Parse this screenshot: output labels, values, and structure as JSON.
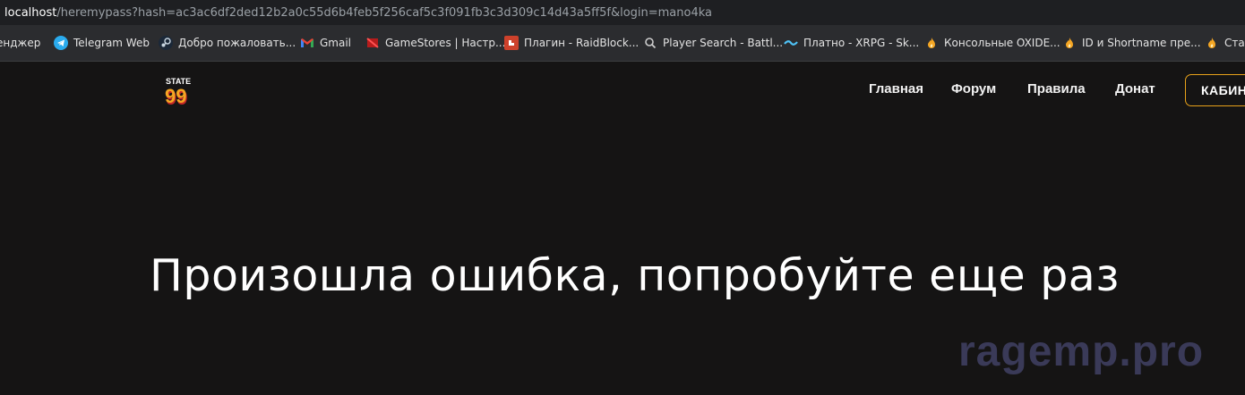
{
  "browser": {
    "address": {
      "host": "localhost",
      "path": "/heremypass?hash=ac3ac6df2ded12b2a0c55d6b4feb5f256caf5c3f091fb3c3d309c14d43a5ff5f&login=mano4ka"
    },
    "bookmarks": [
      {
        "label": "енджер",
        "icon": "none"
      },
      {
        "label": "Telegram Web",
        "icon": "telegram-icon",
        "color": "#2aabee"
      },
      {
        "label": "Добро пожаловать...",
        "icon": "steam-icon",
        "color": "#c7d5e0"
      },
      {
        "label": "Gmail",
        "icon": "gmail-icon",
        "color": "#ea4335"
      },
      {
        "label": "GameStores | Настр...",
        "icon": "gamestores-icon",
        "color": "#e53935"
      },
      {
        "label": "Плагин - RaidBlock...",
        "icon": "rust-icon",
        "color": "#cd412b"
      },
      {
        "label": "Player Search - Battl...",
        "icon": "search-icon",
        "color": "#cccccc"
      },
      {
        "label": "Платно - XRPG - Sk...",
        "icon": "xrpg-icon",
        "color": "#4fc3f7"
      },
      {
        "label": "Консольные OXIDE...",
        "icon": "flame-icon",
        "color": "#f5a623"
      },
      {
        "label": "ID и Shortname пре...",
        "icon": "flame-icon",
        "color": "#f5a623"
      },
      {
        "label": "Стан",
        "icon": "flame-icon",
        "color": "#f5a623"
      }
    ]
  },
  "site": {
    "logo": {
      "top": "STATE",
      "number": "99"
    },
    "nav": [
      "Главная",
      "Форум",
      "Правила",
      "Донат"
    ],
    "cabinet_label": "КАБИН",
    "error_message": "Произошла ошибка, попробуйте еще раз",
    "watermark": "ragemp.pro",
    "accent_color": "#e8a21a"
  }
}
